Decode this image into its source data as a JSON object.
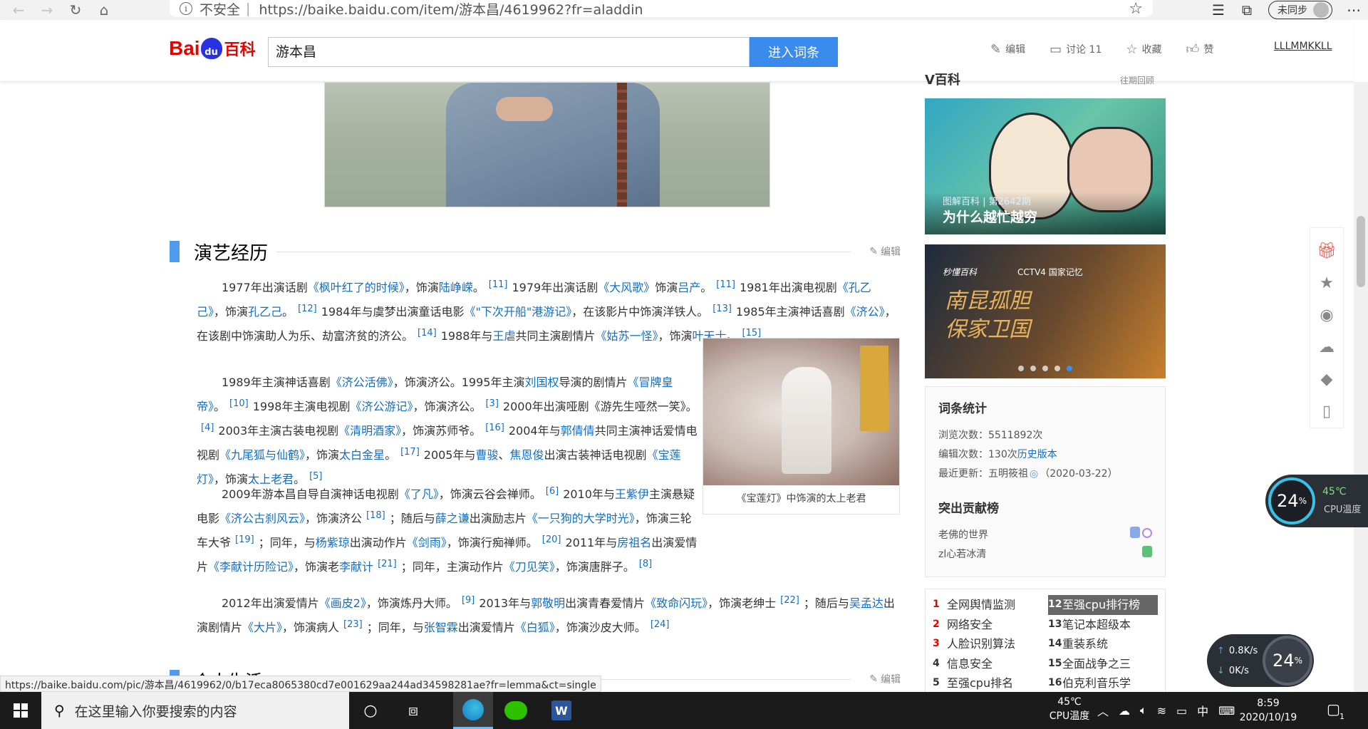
{
  "browser": {
    "insecure_label": "不安全",
    "separator": "|",
    "url": "https://baike.baidu.com/item/游本昌/4619962?fr=aladdin",
    "sync_label": "未同步"
  },
  "header": {
    "logo_bai": "Bai",
    "logo_du": "du",
    "logo_baike": "百科",
    "search_value": "游本昌",
    "search_button": "进入词条",
    "actions": [
      {
        "icon": "pencil-icon",
        "label": "编辑"
      },
      {
        "icon": "comment-icon",
        "label": "讨论 11"
      },
      {
        "icon": "star-icon",
        "label": "收藏"
      },
      {
        "icon": "thumbs-up-icon",
        "label": "赞"
      }
    ],
    "username": "LLLMMKKLL"
  },
  "section": {
    "title": "演艺经历",
    "edit": "编辑",
    "next_title": "个人生活",
    "next_edit": "编辑"
  },
  "figure": {
    "caption": "《宝莲灯》中饰演的太上老君"
  },
  "sidebar": {
    "head_title": "V百科",
    "head_more": "往期回顾",
    "card1_sub": "图解百科 | 第2642期",
    "card1_title": "为什么越忙越穷",
    "card2_brand": "秒懂百科",
    "card2_brand2": "CCTV4 国家记忆",
    "card2_calligraphy": "南昆孤胆 保家卫国",
    "stats_title": "词条统计",
    "views_label": "浏览次数：",
    "views": "5511892次",
    "edits_label": "编辑次数：",
    "edits": "130次",
    "history_link": "历史版本",
    "updated_label": "最近更新：",
    "updated_user": "五明筱祖",
    "updated_date": "（2020-03-22）",
    "contrib_title": "突出贡献榜",
    "contributors": [
      "老佛的世界",
      "zl心若冰清"
    ]
  },
  "hot": [
    {
      "num": "1",
      "label": "全网舆情监测",
      "red": true
    },
    {
      "num": "12",
      "label": "至强cpu排行榜",
      "red": false,
      "selected": true
    },
    {
      "num": "2",
      "label": "网络安全",
      "red": true
    },
    {
      "num": "13",
      "label": "笔记本超级本",
      "red": false
    },
    {
      "num": "3",
      "label": "人脸识别算法",
      "red": true
    },
    {
      "num": "14",
      "label": "重装系统",
      "red": false
    },
    {
      "num": "4",
      "label": "信息安全",
      "red": false
    },
    {
      "num": "15",
      "label": "全面战争之三",
      "red": false
    },
    {
      "num": "5",
      "label": "至强cpu排名",
      "red": false
    },
    {
      "num": "16",
      "label": "伯克利音乐学",
      "red": false
    }
  ],
  "widgets": {
    "cpu_percent": "24",
    "cpu_temp": "45℃",
    "cpu_label": "CPU温度",
    "net_up": "0.8",
    "net_down": "0",
    "net_unit": "K/s",
    "net_percent": "24"
  },
  "status_url": "https://baike.baidu.com/pic/游本昌/4619962/0/b17eca8065380cd7e001629aa244ad34598281ae?fr=lemma&ct=single",
  "taskbar": {
    "search_placeholder": "在这里输入你要搜索的内容",
    "temp": "45℃",
    "temp_label": "CPU温度",
    "ime": "中",
    "time": "8:59",
    "date": "2020/10/19",
    "notif_count": "1"
  }
}
